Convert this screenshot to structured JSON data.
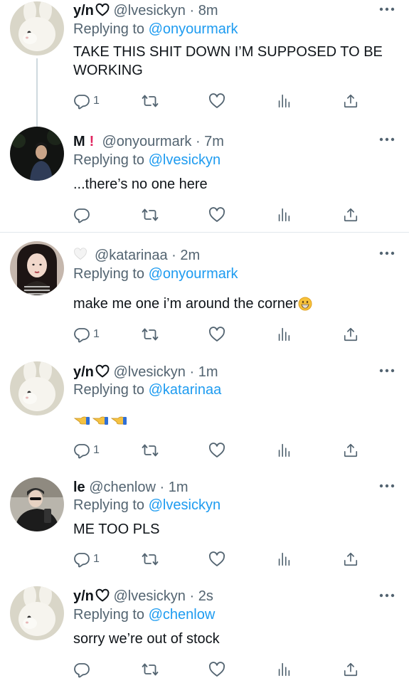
{
  "tweets": [
    {
      "name": "y/n",
      "name_emoji": "heart-outline",
      "handle": "@lvesickyn",
      "dot": "·",
      "time": "8m",
      "replying_prefix": "Replying to",
      "replying_to": "@onyourmark",
      "text": "TAKE THIS SHIT DOWN I’M SUPPOSED TO BE WORKING",
      "avatar": "bunny",
      "reply_count": "1"
    },
    {
      "name": "M",
      "name_emoji": "red-exclamation",
      "handle": "@onyourmark",
      "dot": "·",
      "time": "7m",
      "replying_prefix": "Replying to",
      "replying_to": "@lvesickyn",
      "text": "...there’s no one here",
      "avatar": "dark-person",
      "reply_count": ""
    },
    {
      "name": "",
      "name_emoji": "white-heart",
      "handle": "@katarinaa",
      "dot": "·",
      "time": "2m",
      "replying_prefix": "Replying to",
      "replying_to": "@onyourmark",
      "text": "make me one i’m around the corner",
      "text_emoji": "grinning-face",
      "avatar": "girl",
      "reply_count": "1"
    },
    {
      "name": "y/n",
      "name_emoji": "heart-outline",
      "handle": "@lvesickyn",
      "dot": "·",
      "time": "1m",
      "replying_prefix": "Replying to",
      "replying_to": "@katarinaa",
      "text": "",
      "text_emoji": "pointing-left-hands",
      "avatar": "bunny",
      "reply_count": "1"
    },
    {
      "name": "le",
      "name_emoji": "",
      "handle": "@chenlow",
      "dot": "·",
      "time": "1m",
      "replying_prefix": "Replying to",
      "replying_to": "@lvesickyn",
      "text": "ME TOO PLS",
      "avatar": "guy-dark",
      "reply_count": "1"
    },
    {
      "name": "y/n",
      "name_emoji": "heart-outline",
      "handle": "@lvesickyn",
      "dot": "·",
      "time": "2s",
      "replying_prefix": "Replying to",
      "replying_to": "@chenlow",
      "text": "sorry we’re out of stock",
      "avatar": "bunny",
      "reply_count": ""
    }
  ],
  "colors": {
    "link": "#1d9bf0",
    "secondary": "#536471",
    "text": "#0f1419",
    "thread_line": "#cfd9de"
  },
  "icons": [
    "reply-icon",
    "retweet-icon",
    "like-icon",
    "analytics-icon",
    "share-icon",
    "more-icon"
  ]
}
